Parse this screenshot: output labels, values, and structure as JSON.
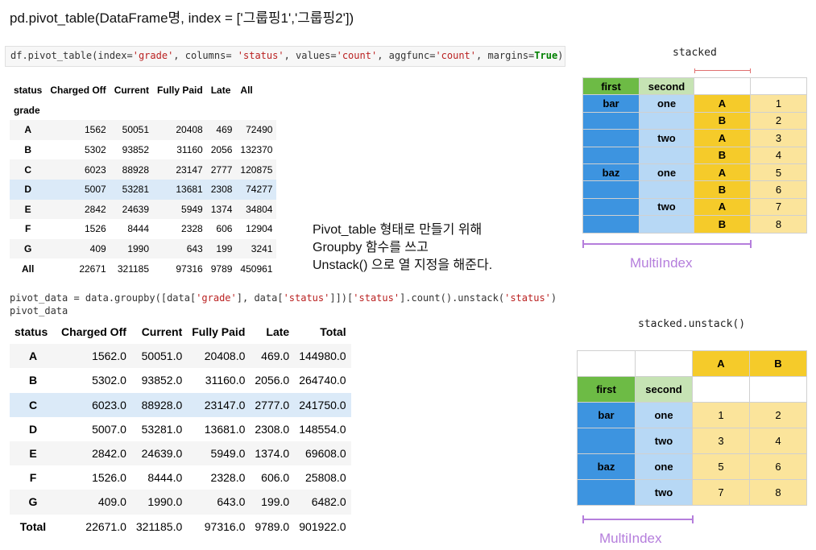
{
  "heading": "pd.pivot_table(DataFrame명, index = ['그룹핑1','그룹핑2'])",
  "code1": {
    "p1": "df.pivot_table(index=",
    "s1": "'grade'",
    "p2": ", columns= ",
    "s2": "'status'",
    "p3": ", values=",
    "s3": "'count'",
    "p4": ", aggfunc=",
    "s4": "'count'",
    "p5": ", margins=",
    "k1": "True",
    "p6": ")"
  },
  "table1": {
    "header": [
      "status",
      "Charged Off",
      "Current",
      "Fully Paid",
      "Late",
      "All"
    ],
    "index_name": "grade",
    "rows": [
      {
        "idx": "A",
        "v": [
          "1562",
          "50051",
          "20408",
          "469",
          "72490"
        ]
      },
      {
        "idx": "B",
        "v": [
          "5302",
          "93852",
          "31160",
          "2056",
          "132370"
        ]
      },
      {
        "idx": "C",
        "v": [
          "6023",
          "88928",
          "23147",
          "2777",
          "120875"
        ]
      },
      {
        "idx": "D",
        "v": [
          "5007",
          "53281",
          "13681",
          "2308",
          "74277"
        ]
      },
      {
        "idx": "E",
        "v": [
          "2842",
          "24639",
          "5949",
          "1374",
          "34804"
        ]
      },
      {
        "idx": "F",
        "v": [
          "1526",
          "8444",
          "2328",
          "606",
          "12904"
        ]
      },
      {
        "idx": "G",
        "v": [
          "409",
          "1990",
          "643",
          "199",
          "3241"
        ]
      },
      {
        "idx": "All",
        "v": [
          "22671",
          "321185",
          "97316",
          "9789",
          "450961"
        ]
      }
    ]
  },
  "note": {
    "line1": "Pivot_table 형태로 만들기 위해",
    "line2": "Groupby 함수를 쓰고",
    "line3": "Unstack() 으로 열 지정을 해준다."
  },
  "code2": {
    "a1": "pivot_data = data.groupby([data[",
    "s1": "'grade'",
    "a2": "], data[",
    "s2": "'status'",
    "a3": "]])[",
    "s3": "'status'",
    "a4": "].count().unstack(",
    "s4": "'status'",
    "a5": ")",
    "line2": "pivot_data"
  },
  "table2": {
    "header": [
      "status",
      "Charged Off",
      "Current",
      "Fully Paid",
      "Late",
      "Total"
    ],
    "rows": [
      {
        "idx": "A",
        "v": [
          "1562.0",
          "50051.0",
          "20408.0",
          "469.0",
          "144980.0"
        ]
      },
      {
        "idx": "B",
        "v": [
          "5302.0",
          "93852.0",
          "31160.0",
          "2056.0",
          "264740.0"
        ]
      },
      {
        "idx": "C",
        "v": [
          "6023.0",
          "88928.0",
          "23147.0",
          "2777.0",
          "241750.0"
        ]
      },
      {
        "idx": "D",
        "v": [
          "5007.0",
          "53281.0",
          "13681.0",
          "2308.0",
          "148554.0"
        ]
      },
      {
        "idx": "E",
        "v": [
          "2842.0",
          "24639.0",
          "5949.0",
          "1374.0",
          "69608.0"
        ]
      },
      {
        "idx": "F",
        "v": [
          "1526.0",
          "8444.0",
          "2328.0",
          "606.0",
          "25808.0"
        ]
      },
      {
        "idx": "G",
        "v": [
          "409.0",
          "1990.0",
          "643.0",
          "199.0",
          "6482.0"
        ]
      },
      {
        "idx": "Total",
        "v": [
          "22671.0",
          "321185.0",
          "97316.0",
          "9789.0",
          "901922.0"
        ]
      }
    ]
  },
  "stacked": {
    "caption": "stacked",
    "head": [
      "first",
      "second"
    ],
    "first": [
      "bar",
      "baz"
    ],
    "second": [
      "one",
      "two"
    ],
    "letters": [
      "A",
      "B"
    ],
    "values": [
      "1",
      "2",
      "3",
      "4",
      "5",
      "6",
      "7",
      "8"
    ],
    "multiindex": "MultiIndex"
  },
  "unstacked": {
    "caption": "stacked.unstack()",
    "cols": [
      "A",
      "B"
    ],
    "head": [
      "first",
      "second"
    ],
    "first": [
      "bar",
      "baz"
    ],
    "second": [
      "one",
      "two"
    ],
    "values": [
      "1",
      "2",
      "3",
      "4",
      "5",
      "6",
      "7",
      "8"
    ],
    "multiindex": "MultiIndex"
  },
  "colors": {
    "green": "#6dbb45",
    "light_green": "#c6e3b4",
    "blue": "#3d94e0",
    "light_blue": "#b7d8f5",
    "yellow": "#f5cb2a",
    "light_yellow": "#fbe49b",
    "purple": "#b57edc"
  }
}
